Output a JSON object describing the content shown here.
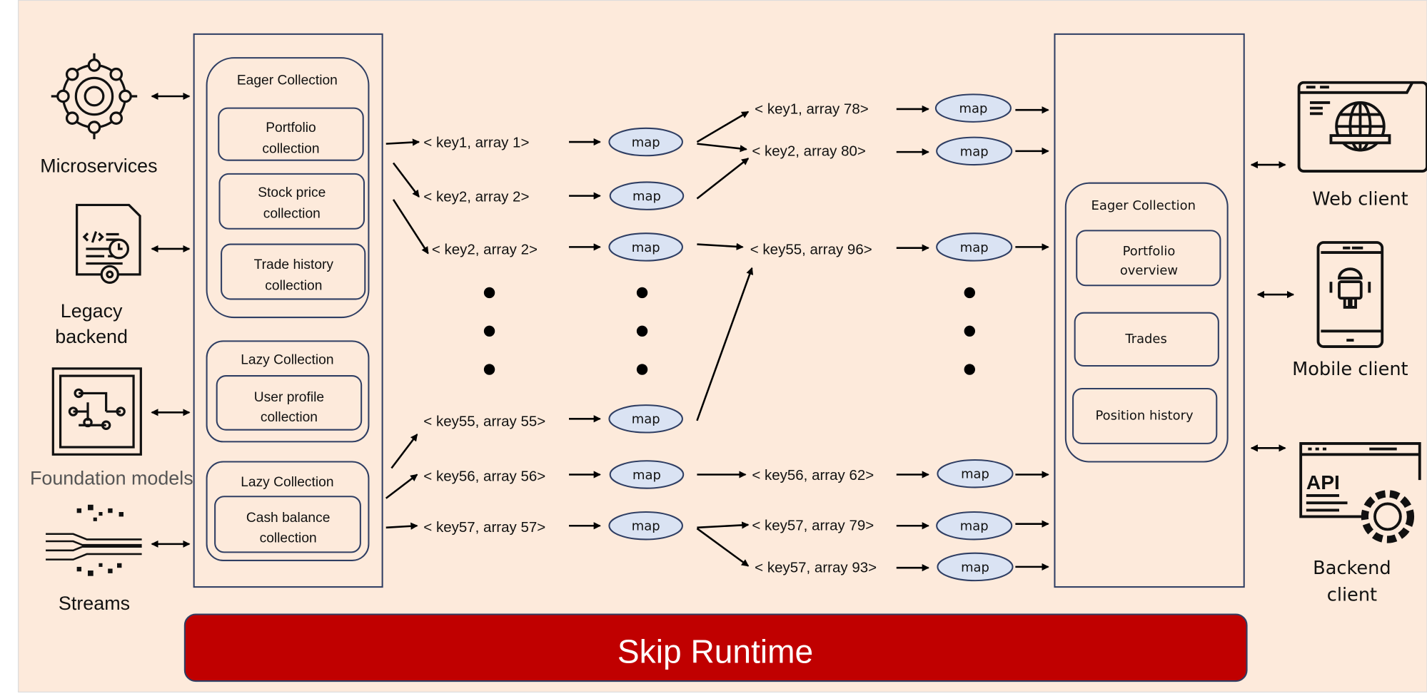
{
  "title": "Skip Runtime",
  "colors": {
    "background": "#fdeadb",
    "runtime_bar": "#c00000",
    "border": "#2f3e63",
    "map_fill": "#dae3f3"
  },
  "sources": [
    {
      "label": [
        "Microservices"
      ],
      "icon": "microservices-network-icon"
    },
    {
      "label": [
        "Legacy",
        "backend"
      ],
      "icon": "document-code-clock-gear-icon"
    },
    {
      "label": [
        "Foundation models"
      ],
      "icon": "circuit-chip-icon"
    },
    {
      "label": [
        "Streams"
      ],
      "icon": "data-stream-icon"
    }
  ],
  "input_collections": [
    {
      "title": "Eager Collection",
      "items": [
        [
          "Portfolio",
          "collection"
        ],
        [
          "Stock price",
          "collection"
        ],
        [
          "Trade history",
          "collection"
        ]
      ]
    },
    {
      "title": "Lazy Collection",
      "items": [
        [
          "User profile",
          "collection"
        ]
      ]
    },
    {
      "title": "Lazy Collection",
      "items": [
        [
          "Cash balance",
          "collection"
        ]
      ]
    }
  ],
  "input_keys": [
    "< key1, array 1>",
    "< key2, array 2>",
    "< key2, array 2>",
    "< key55, array 55>",
    "< key56, array 56>",
    "< key57, array 57>"
  ],
  "map_label": "map",
  "output_keys": [
    "< key1, array 78>",
    "< key2, array 80>",
    "< key55, array 96>",
    "< key56, array 62>",
    "< key57, array 79>",
    "< key57, array 93>"
  ],
  "output_collection": {
    "title": "Eager Collection",
    "items": [
      [
        "Portfolio",
        "overview"
      ],
      [
        "Trades"
      ],
      [
        "Position history"
      ]
    ]
  },
  "clients": [
    {
      "label": [
        "Web client"
      ],
      "icon": "web-browser-globe-icon"
    },
    {
      "label": [
        "Mobile client"
      ],
      "icon": "mobile-android-icon"
    },
    {
      "label": [
        "Backend",
        "client"
      ],
      "icon": "api-gear-icon"
    }
  ]
}
